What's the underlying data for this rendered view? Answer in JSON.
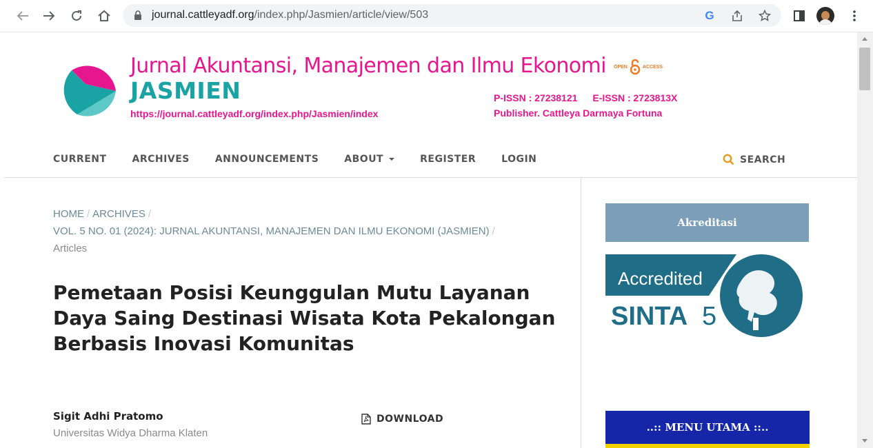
{
  "browser": {
    "url_host": "journal.cattleyadf.org",
    "url_path": "/index.php/Jasmien/article/view/503"
  },
  "header": {
    "journal_title": "Jurnal Akuntansi, Manajemen dan Ilmu Ekonomi",
    "journal_abbr": "JASMIEN",
    "journal_url": "https://journal.cattleyadf.org/index.php/Jasmien/index",
    "open_access_left": "OPEN",
    "open_access_right": "ACCESS",
    "p_issn": "P-ISSN : 27238121",
    "e_issn": "E-ISSN : 2723813X",
    "publisher": "Publisher. Cattleya Darmaya Fortuna",
    "colors": {
      "magenta": "#e6168f",
      "teal": "#1aa3a4",
      "orange": "#f07a22"
    }
  },
  "nav": {
    "items": [
      {
        "label": "CURRENT"
      },
      {
        "label": "ARCHIVES"
      },
      {
        "label": "ANNOUNCEMENTS"
      },
      {
        "label": "ABOUT"
      },
      {
        "label": "REGISTER"
      },
      {
        "label": "LOGIN"
      }
    ],
    "search_label": "SEARCH"
  },
  "breadcrumb": {
    "home": "HOME",
    "archives": "ARCHIVES",
    "issue": "VOL. 5 NO. 01 (2024): JURNAL AKUNTANSI, MANAJEMEN DAN ILMU EKONOMI (JASMIEN)",
    "current": "Articles"
  },
  "article": {
    "title": "Pemetaan Posisi Keunggulan Mutu Layanan Daya Saing Destinasi Wisata Kota Pekalongan Berbasis Inovasi Komunitas",
    "author_name": "Sigit Adhi Pratomo",
    "author_affiliation": "Universitas Widya Dharma Klaten",
    "download_label": "DOWNLOAD"
  },
  "sidebar": {
    "akreditasi_label": "Akreditasi",
    "accredited_text": "Accredited",
    "sinta_text": "SINTA",
    "sinta_level": "5",
    "menu_label": "..:: MENU UTAMA ::.."
  }
}
